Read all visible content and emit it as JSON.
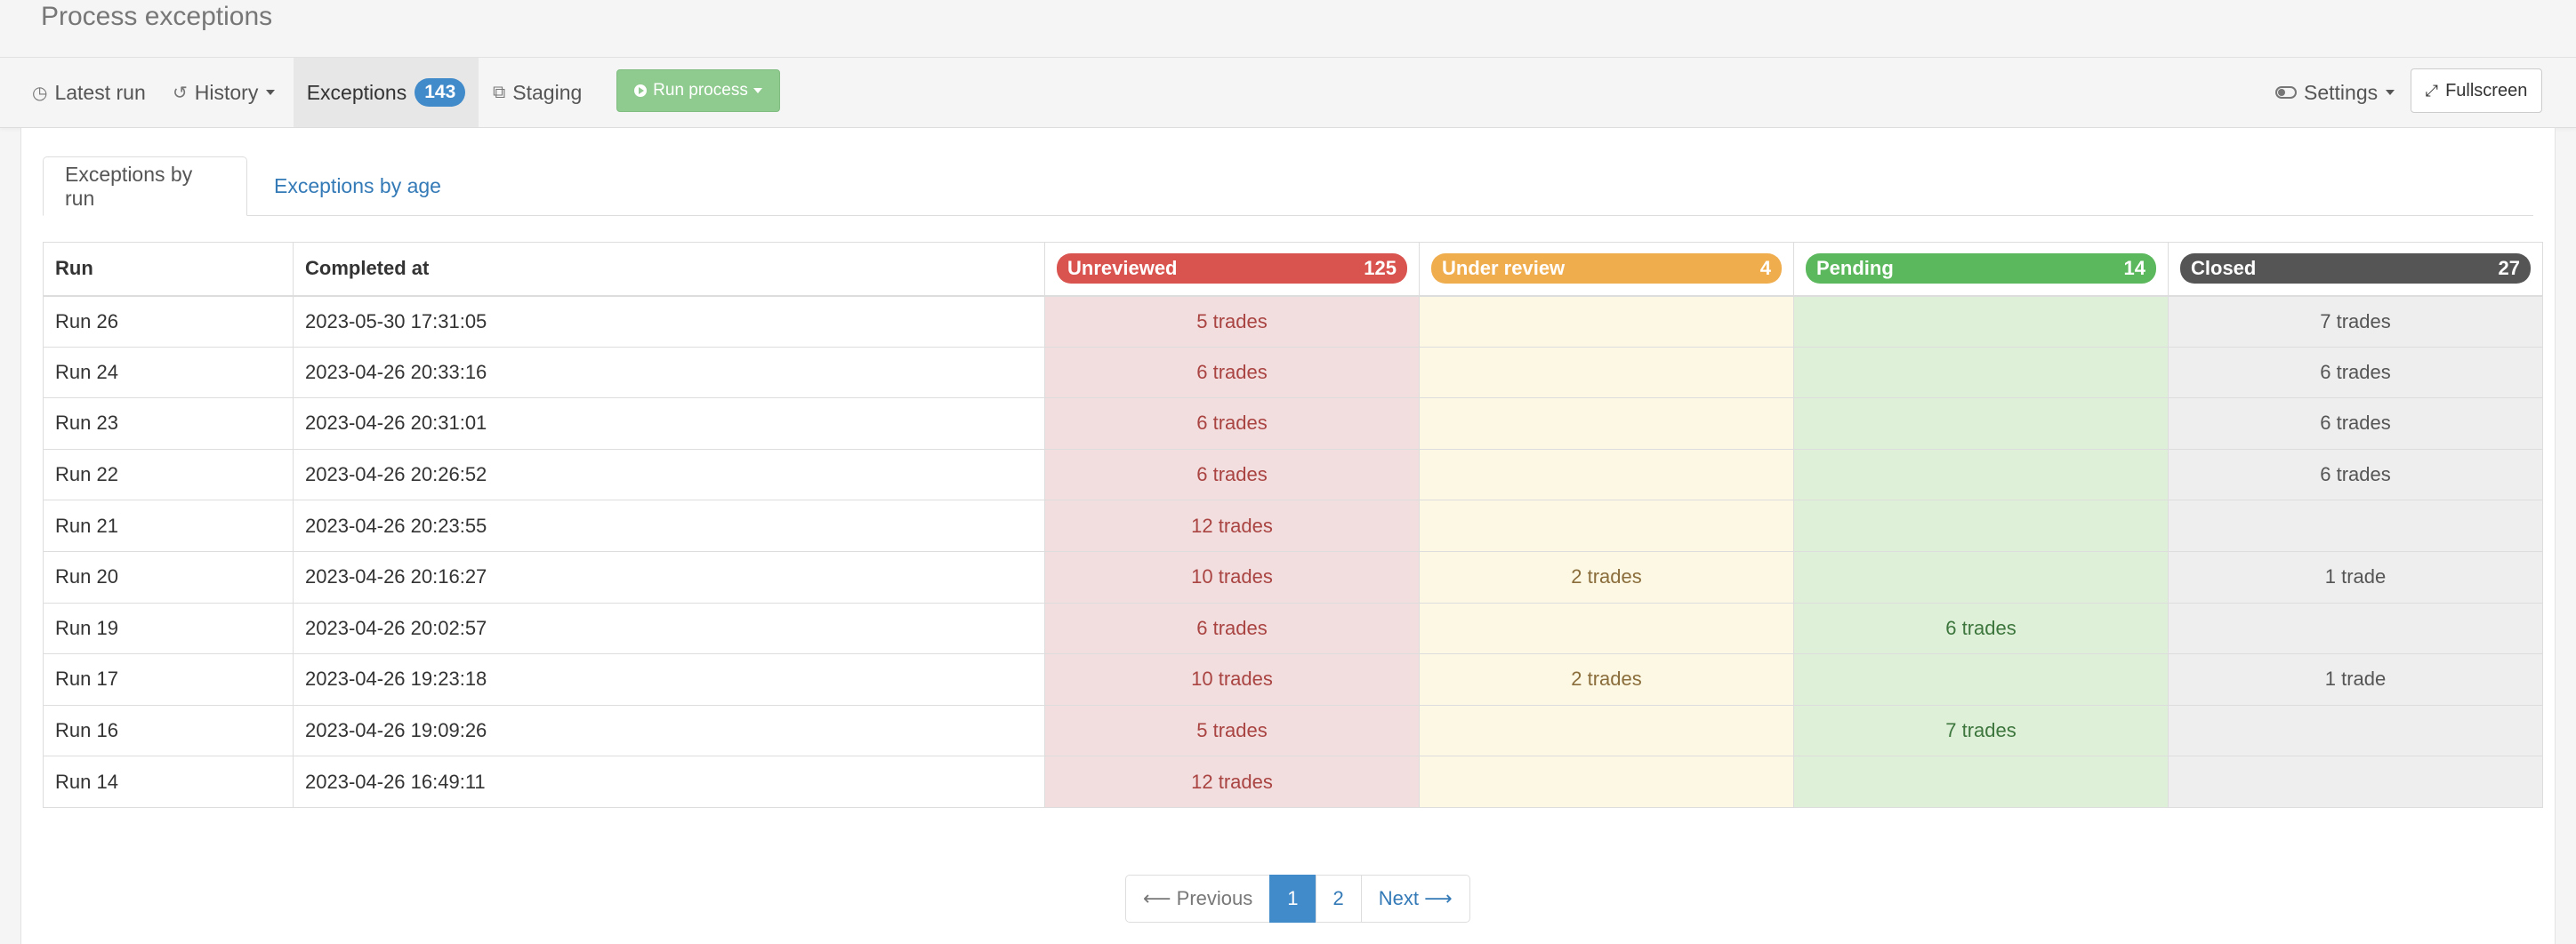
{
  "header": {
    "subtitle": "Process exceptions"
  },
  "toolbar": {
    "latest_run": "Latest run",
    "history": "History",
    "exceptions": "Exceptions",
    "exceptions_count": "143",
    "staging": "Staging",
    "run_process": "Run process",
    "settings": "Settings",
    "fullscreen": "Fullscreen"
  },
  "tabs": [
    {
      "label": "Exceptions by run",
      "active": true
    },
    {
      "label": "Exceptions by age",
      "active": false
    }
  ],
  "table": {
    "columns": {
      "run": "Run",
      "completed_at": "Completed at"
    },
    "statuses": [
      {
        "label": "Unreviewed",
        "count": "125",
        "color": "#d9534f"
      },
      {
        "label": "Under review",
        "count": "4",
        "color": "#f0ad4e"
      },
      {
        "label": "Pending",
        "count": "14",
        "color": "#5cb85c"
      },
      {
        "label": "Closed",
        "count": "27",
        "color": "#555555"
      }
    ],
    "rows": [
      {
        "run": "Run 26",
        "completed_at": "2023-05-30 17:31:05",
        "unreviewed": "5 trades",
        "under_review": "",
        "pending": "",
        "closed": "7 trades"
      },
      {
        "run": "Run 24",
        "completed_at": "2023-04-26 20:33:16",
        "unreviewed": "6 trades",
        "under_review": "",
        "pending": "",
        "closed": "6 trades"
      },
      {
        "run": "Run 23",
        "completed_at": "2023-04-26 20:31:01",
        "unreviewed": "6 trades",
        "under_review": "",
        "pending": "",
        "closed": "6 trades"
      },
      {
        "run": "Run 22",
        "completed_at": "2023-04-26 20:26:52",
        "unreviewed": "6 trades",
        "under_review": "",
        "pending": "",
        "closed": "6 trades"
      },
      {
        "run": "Run 21",
        "completed_at": "2023-04-26 20:23:55",
        "unreviewed": "12 trades",
        "under_review": "",
        "pending": "",
        "closed": ""
      },
      {
        "run": "Run 20",
        "completed_at": "2023-04-26 20:16:27",
        "unreviewed": "10 trades",
        "under_review": "2 trades",
        "pending": "",
        "closed": "1 trade"
      },
      {
        "run": "Run 19",
        "completed_at": "2023-04-26 20:02:57",
        "unreviewed": "6 trades",
        "under_review": "",
        "pending": "6 trades",
        "closed": ""
      },
      {
        "run": "Run 17",
        "completed_at": "2023-04-26 19:23:18",
        "unreviewed": "10 trades",
        "under_review": "2 trades",
        "pending": "",
        "closed": "1 trade"
      },
      {
        "run": "Run 16",
        "completed_at": "2023-04-26 19:09:26",
        "unreviewed": "5 trades",
        "under_review": "",
        "pending": "7 trades",
        "closed": ""
      },
      {
        "run": "Run 14",
        "completed_at": "2023-04-26 16:49:11",
        "unreviewed": "12 trades",
        "under_review": "",
        "pending": "",
        "closed": ""
      }
    ]
  },
  "pagination": {
    "previous": "⟵ Previous",
    "pages": [
      "1",
      "2"
    ],
    "current": "1",
    "next": "Next ⟶"
  }
}
